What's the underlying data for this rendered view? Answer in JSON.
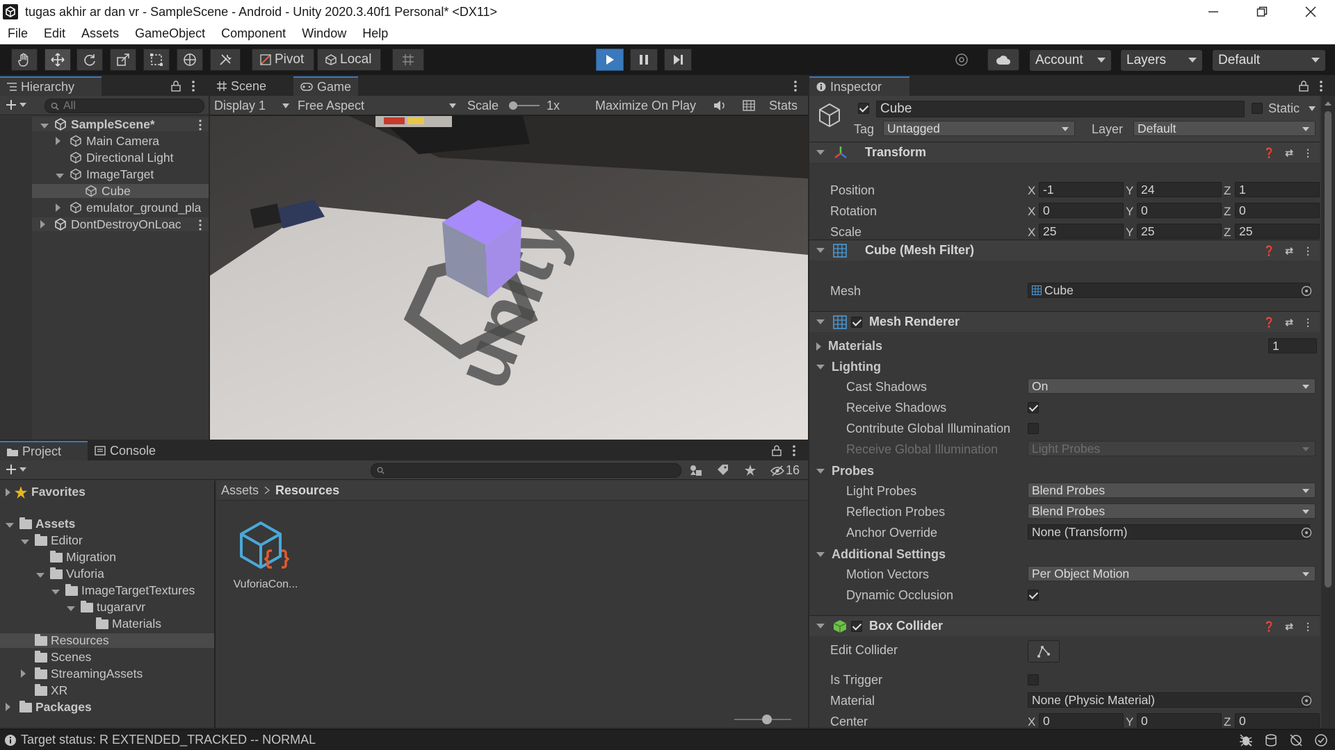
{
  "window": {
    "title": "tugas akhir ar dan vr - SampleScene - Android - Unity 2020.3.40f1 Personal* <DX11>"
  },
  "menu": [
    "File",
    "Edit",
    "Assets",
    "GameObject",
    "Component",
    "Window",
    "Help"
  ],
  "toolbar": {
    "pivot": "Pivot",
    "local": "Local",
    "account": "Account",
    "layers": "Layers",
    "layout": "Default"
  },
  "hierarchy": {
    "tab": "Hierarchy",
    "search_placeholder": "All",
    "items": [
      {
        "label": "SampleScene*",
        "depth": 0,
        "expanded": true,
        "icon": "unity-scene-icon",
        "bold": true
      },
      {
        "label": "Main Camera",
        "depth": 1,
        "expanded": false,
        "icon": "gameobject-icon"
      },
      {
        "label": "Directional Light",
        "depth": 1,
        "icon": "gameobject-icon"
      },
      {
        "label": "ImageTarget",
        "depth": 1,
        "expanded": true,
        "icon": "gameobject-icon"
      },
      {
        "label": "Cube",
        "depth": 2,
        "icon": "gameobject-icon",
        "selected": true
      },
      {
        "label": "emulator_ground_pla",
        "depth": 1,
        "expanded": false,
        "icon": "gameobject-icon"
      },
      {
        "label": "DontDestroyOnLoac",
        "depth": 0,
        "expanded": false,
        "icon": "unity-scene-icon"
      }
    ]
  },
  "game": {
    "tabs": [
      "Scene",
      "Game"
    ],
    "display": "Display 1",
    "aspect": "Free Aspect",
    "scale_label": "Scale",
    "scale_value": "1x",
    "maximize": "Maximize On Play",
    "stats": "Stats"
  },
  "project": {
    "tabs": [
      "Project",
      "Console"
    ],
    "hidden_count": "16",
    "favorites": "Favorites",
    "tree": [
      {
        "label": "Assets",
        "depth": 0,
        "expanded": true,
        "bold": true
      },
      {
        "label": "Editor",
        "depth": 1,
        "expanded": true
      },
      {
        "label": "Migration",
        "depth": 2
      },
      {
        "label": "Vuforia",
        "depth": 2,
        "expanded": true
      },
      {
        "label": "ImageTargetTextures",
        "depth": 3,
        "expanded": true
      },
      {
        "label": "tugararvr",
        "depth": 4,
        "expanded": true
      },
      {
        "label": "Materials",
        "depth": 5
      },
      {
        "label": "Resources",
        "depth": 1,
        "selected": true
      },
      {
        "label": "Scenes",
        "depth": 1
      },
      {
        "label": "StreamingAssets",
        "depth": 1,
        "expanded": false
      },
      {
        "label": "XR",
        "depth": 1
      },
      {
        "label": "Packages",
        "depth": 0,
        "expanded": false,
        "bold": true
      }
    ],
    "breadcrumb": [
      "Assets",
      "Resources"
    ],
    "asset_name": "VuforiaCon..."
  },
  "inspector": {
    "tab": "Inspector",
    "object_name": "Cube",
    "static": "Static",
    "tag_label": "Tag",
    "tag": "Untagged",
    "layer_label": "Layer",
    "layer": "Default",
    "transform": {
      "title": "Transform",
      "position_label": "Position",
      "rotation_label": "Rotation",
      "scale_label": "Scale",
      "position": [
        "-1",
        "24",
        "1"
      ],
      "rotation": [
        "0",
        "0",
        "0"
      ],
      "scale": [
        "25",
        "25",
        "25"
      ]
    },
    "mesh_filter": {
      "title": "Cube (Mesh Filter)",
      "mesh_label": "Mesh",
      "mesh": "Cube"
    },
    "mesh_renderer": {
      "title": "Mesh Renderer",
      "materials_label": "Materials",
      "materials_count": "1",
      "lighting_label": "Lighting",
      "cast_shadows_label": "Cast Shadows",
      "cast_shadows": "On",
      "receive_shadows_label": "Receive Shadows",
      "contribute_gi_label": "Contribute Global Illumination",
      "receive_gi_label": "Receive Global Illumination",
      "receive_gi": "Light Probes",
      "probes_label": "Probes",
      "light_probes_label": "Light Probes",
      "light_probes": "Blend Probes",
      "reflection_probes_label": "Reflection Probes",
      "reflection_probes": "Blend Probes",
      "anchor_override_label": "Anchor Override",
      "anchor_override": "None (Transform)",
      "additional_label": "Additional Settings",
      "motion_vectors_label": "Motion Vectors",
      "motion_vectors": "Per Object Motion",
      "dynamic_occlusion_label": "Dynamic Occlusion"
    },
    "box_collider": {
      "title": "Box Collider",
      "edit_collider_label": "Edit Collider",
      "is_trigger_label": "Is Trigger",
      "material_label": "Material",
      "material": "None (Physic Material)",
      "center_label": "Center",
      "center": [
        "0",
        "0",
        "0"
      ]
    }
  },
  "status": {
    "message": "Target status: R EXTENDED_TRACKED -- NORMAL"
  },
  "colors": {
    "accent": "#3a79bb",
    "cube_top": "#a78bfa",
    "cube_side": "#8c8fa8"
  },
  "axes": [
    "X",
    "Y",
    "Z"
  ]
}
